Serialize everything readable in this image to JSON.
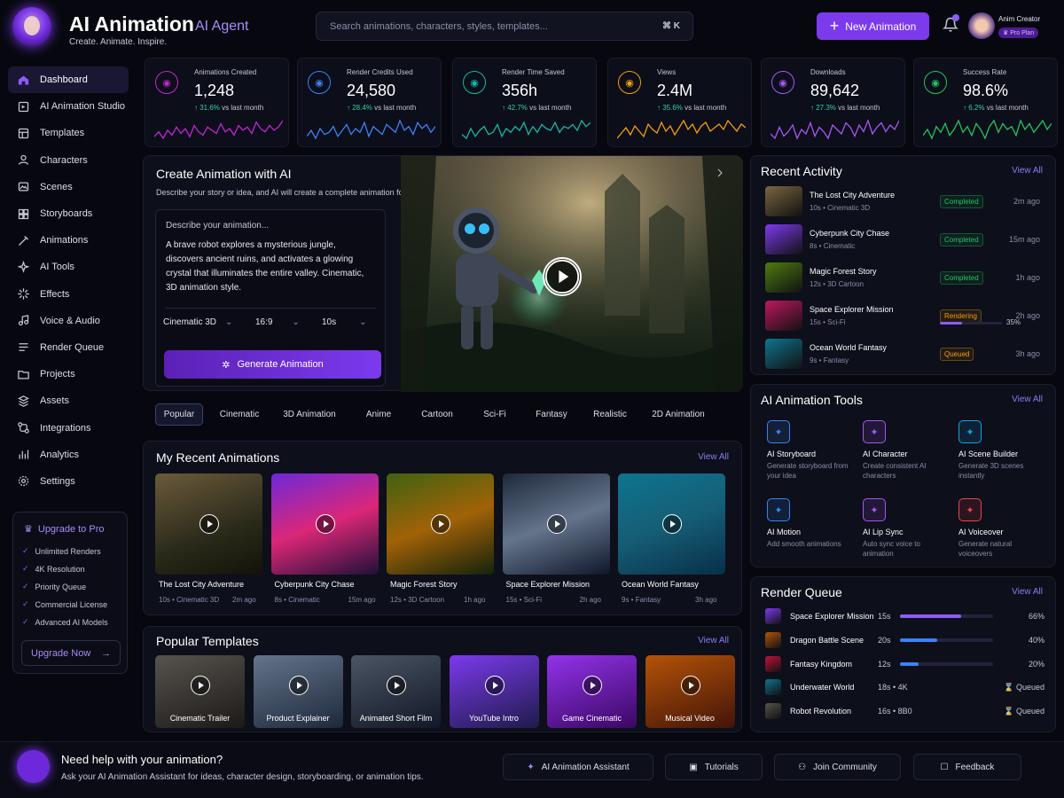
{
  "header": {
    "title": "AI Animation",
    "badge": "AI Agent",
    "tagline": "Create. Animate. Inspire.",
    "search_placeholder": "Search animations, characters, styles, templates...",
    "search_shortcut": "⌘ K",
    "new_button": "New Animation",
    "user_name": "Anim Creator",
    "user_plan": "Pro Plan"
  },
  "sidebar": {
    "items": [
      {
        "label": "Dashboard",
        "icon": "home-icon"
      },
      {
        "label": "AI Animation Studio",
        "icon": "studio-icon"
      },
      {
        "label": "Templates",
        "icon": "templates-icon"
      },
      {
        "label": "Characters",
        "icon": "characters-icon"
      },
      {
        "label": "Scenes",
        "icon": "scenes-icon"
      },
      {
        "label": "Storyboards",
        "icon": "storyboards-icon"
      },
      {
        "label": "Animations",
        "icon": "animations-icon"
      },
      {
        "label": "AI Tools",
        "icon": "ai-tools-icon"
      },
      {
        "label": "Effects",
        "icon": "effects-icon"
      },
      {
        "label": "Voice & Audio",
        "icon": "voice-icon"
      },
      {
        "label": "Render Queue",
        "icon": "render-icon"
      },
      {
        "label": "Projects",
        "icon": "projects-icon"
      },
      {
        "label": "Assets",
        "icon": "assets-icon"
      },
      {
        "label": "Integrations",
        "icon": "integrations-icon"
      },
      {
        "label": "Analytics",
        "icon": "analytics-icon"
      },
      {
        "label": "Settings",
        "icon": "settings-icon"
      }
    ],
    "upgrade": {
      "title": "Upgrade to Pro",
      "features": [
        "Unlimited Renders",
        "4K Resolution",
        "Priority Queue",
        "Commercial License",
        "Advanced AI Models"
      ],
      "button": "Upgrade Now"
    }
  },
  "stats": [
    {
      "label": "Animations Created",
      "value": "1,248",
      "change": "31.6%",
      "suffix": "vs last month",
      "color": "#c026d3",
      "icon": "video-icon",
      "spark": [
        6,
        9,
        5,
        10,
        7,
        12,
        8,
        11,
        6,
        13,
        9,
        7,
        12,
        10,
        8,
        14,
        9,
        11,
        7,
        13,
        10,
        12,
        8,
        15,
        11,
        9,
        13,
        10,
        12,
        16
      ]
    },
    {
      "label": "Render Credits Used",
      "value": "24,580",
      "change": "28.4%",
      "suffix": "vs last month",
      "color": "#3b82f6",
      "icon": "database-icon",
      "spark": [
        7,
        10,
        6,
        11,
        8,
        9,
        12,
        7,
        10,
        13,
        8,
        11,
        9,
        14,
        7,
        12,
        10,
        8,
        13,
        11,
        9,
        15,
        10,
        12,
        8,
        14,
        11,
        13,
        9,
        12
      ]
    },
    {
      "label": "Render Time Saved",
      "value": "356h",
      "change": "42.7%",
      "suffix": "vs last month",
      "color": "#14b8a6",
      "icon": "timer-icon",
      "spark": [
        8,
        6,
        11,
        7,
        10,
        12,
        8,
        9,
        13,
        7,
        11,
        9,
        12,
        10,
        14,
        8,
        12,
        9,
        13,
        11,
        10,
        14,
        9,
        12,
        11,
        13,
        10,
        15,
        12,
        14
      ]
    },
    {
      "label": "Views",
      "value": "2.4M",
      "change": "35.6%",
      "suffix": "vs last month",
      "color": "#f59e0b",
      "icon": "eye-icon",
      "spark": [
        5,
        8,
        11,
        7,
        12,
        9,
        6,
        13,
        10,
        8,
        14,
        9,
        12,
        7,
        11,
        15,
        10,
        13,
        8,
        12,
        14,
        9,
        11,
        13,
        10,
        15,
        12,
        9,
        13,
        11
      ]
    },
    {
      "label": "Downloads",
      "value": "89,642",
      "change": "27.3%",
      "suffix": "vs last month",
      "color": "#a855f7",
      "icon": "download-icon",
      "spark": [
        9,
        7,
        12,
        8,
        10,
        13,
        7,
        11,
        9,
        14,
        8,
        12,
        10,
        7,
        13,
        11,
        9,
        14,
        12,
        8,
        13,
        10,
        15,
        9,
        12,
        14,
        10,
        13,
        11,
        15
      ]
    },
    {
      "label": "Success Rate",
      "value": "98.6%",
      "change": "6.2%",
      "suffix": "vs last month",
      "color": "#22c55e",
      "icon": "trend-icon",
      "spark": [
        10,
        12,
        9,
        13,
        11,
        14,
        10,
        12,
        15,
        11,
        13,
        10,
        14,
        12,
        9,
        13,
        15,
        11,
        14,
        12,
        13,
        10,
        15,
        12,
        14,
        11,
        13,
        15,
        12,
        14
      ]
    }
  ],
  "create": {
    "title": "Create Animation with AI",
    "description": "Describe your story or idea, and AI will create a complete animation for you.",
    "prompt_placeholder": "Describe your animation...",
    "prompt_text": "A brave robot explores a mysterious jungle, discovers ancient ruins, and activates a glowing crystal that illuminates the entire valley. Cinematic, 3D animation style.",
    "style": "Cinematic 3D",
    "ratio": "16:9",
    "duration": "10s",
    "button": "Generate Animation"
  },
  "style_tabs": [
    "Popular",
    "Cinematic",
    "3D Animation",
    "Anime",
    "Cartoon",
    "Sci-Fi",
    "Fantasy",
    "Realistic",
    "2D Animation"
  ],
  "recent_animations": {
    "title": "My Recent Animations",
    "view_all": "View All",
    "items": [
      {
        "title": "The Lost City Adventure",
        "meta": "10s • Cinematic 3D",
        "time": "2m ago"
      },
      {
        "title": "Cyberpunk City Chase",
        "meta": "8s • Cinematic",
        "time": "15m ago"
      },
      {
        "title": "Magic Forest Story",
        "meta": "12s • 3D Cartoon",
        "time": "1h ago"
      },
      {
        "title": "Space Explorer Mission",
        "meta": "15s • Sci-Fi",
        "time": "2h ago"
      },
      {
        "title": "Ocean World Fantasy",
        "meta": "9s • Fantasy",
        "time": "3h ago"
      }
    ]
  },
  "templates": {
    "title": "Popular Templates",
    "view_all": "View All",
    "items": [
      "Cinematic Trailer",
      "Product Explainer",
      "Animated Short Film",
      "YouTube Intro",
      "Game Cinematic",
      "Musical Video"
    ]
  },
  "activity": {
    "title": "Recent Activity",
    "view_all": "View All",
    "items": [
      {
        "title": "The Lost City Adventure",
        "meta": "10s • Cinematic 3D",
        "status": "Completed",
        "time": "2m ago"
      },
      {
        "title": "Cyberpunk City Chase",
        "meta": "8s • Cinematic",
        "status": "Completed",
        "time": "15m ago"
      },
      {
        "title": "Magic Forest Story",
        "meta": "12s • 3D Cartoon",
        "status": "Completed",
        "time": "1h ago"
      },
      {
        "title": "Space Explorer Mission",
        "meta": "15s • Sci-Fi",
        "status": "Rendering",
        "progress": "35%",
        "time": "2h ago"
      },
      {
        "title": "Ocean World Fantasy",
        "meta": "9s • Fantasy",
        "status": "Queued",
        "time": "3h ago"
      }
    ]
  },
  "tools": {
    "title": "AI Animation Tools",
    "view_all": "View All",
    "items": [
      {
        "name": "AI Storyboard",
        "desc": "Generate storyboard from your idea",
        "color": "#3b82f6",
        "icon": "storyboard-icon"
      },
      {
        "name": "AI Character",
        "desc": "Create consistent AI characters",
        "color": "#a855f7",
        "icon": "character-icon"
      },
      {
        "name": "AI Scene Builder",
        "desc": "Generate 3D scenes instantly",
        "color": "#0ea5e9",
        "icon": "scene-builder-icon"
      },
      {
        "name": "AI Motion",
        "desc": "Add smooth animations",
        "color": "#3b82f6",
        "icon": "motion-icon"
      },
      {
        "name": "AI Lip Sync",
        "desc": "Auto sync voice to animation",
        "color": "#a855f7",
        "icon": "lip-sync-icon"
      },
      {
        "name": "AI Voiceover",
        "desc": "Generate natural voiceovers",
        "color": "#ef4444",
        "icon": "voiceover-icon"
      }
    ]
  },
  "render_queue": {
    "title": "Render Queue",
    "view_all": "View All",
    "items": [
      {
        "name": "Space Explorer Mission",
        "length": "15s",
        "progress": 0.66,
        "status": "66%",
        "color": "#8b5cf6"
      },
      {
        "name": "Dragon Battle Scene",
        "length": "20s",
        "progress": 0.4,
        "status": "40%",
        "color": "#3b82f6"
      },
      {
        "name": "Fantasy Kingdom",
        "length": "12s",
        "progress": 0.2,
        "status": "20%",
        "color": "#3b82f6"
      },
      {
        "name": "Underwater World",
        "length": "18s • 4K",
        "progress": null,
        "status": "Queued"
      },
      {
        "name": "Robot Revolution",
        "length": "16s • 8B0",
        "progress": null,
        "status": "Queued"
      }
    ]
  },
  "footer": {
    "title": "Need help with your animation?",
    "subtitle": "Ask your AI Animation Assistant for ideas, character design, storyboarding, or animation tips.",
    "buttons": [
      "AI Animation Assistant",
      "Tutorials",
      "Join Community",
      "Feedback"
    ]
  }
}
